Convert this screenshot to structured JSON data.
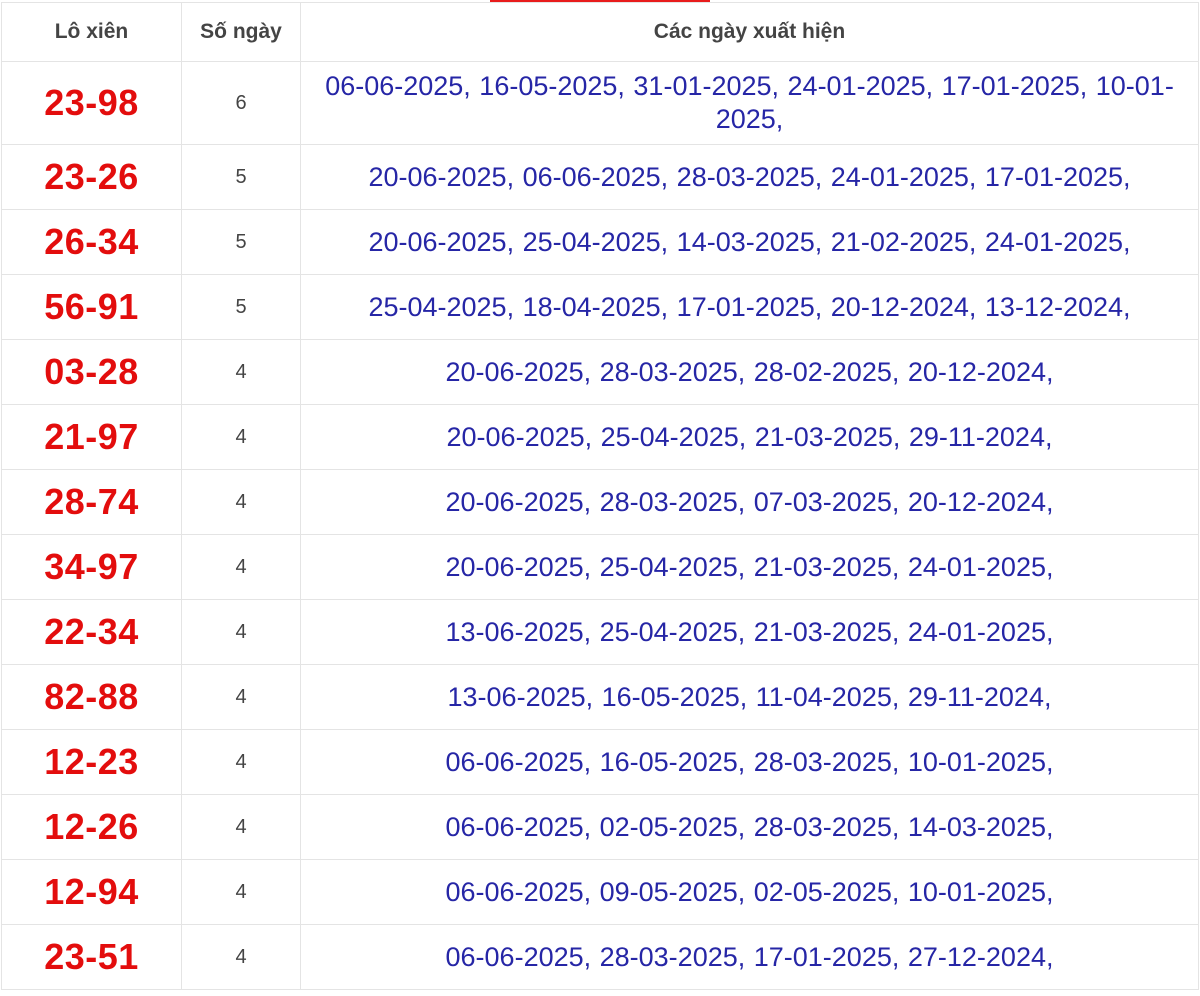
{
  "header": {
    "col_pair": "Lô xiên",
    "col_count": "Số ngày",
    "col_dates": "Các ngày xuất hiện"
  },
  "colors": {
    "accent": "#e81c1c",
    "pair_text": "#e30d0d",
    "dates_text": "#2626a6",
    "header_text": "#444444",
    "border": "#e4e4e4"
  },
  "rows": [
    {
      "pair": "23-98",
      "count": "6",
      "dates": "06-06-2025, 16-05-2025, 31-01-2025, 24-01-2025, 17-01-2025, 10-01-2025,"
    },
    {
      "pair": "23-26",
      "count": "5",
      "dates": "20-06-2025, 06-06-2025, 28-03-2025, 24-01-2025, 17-01-2025,"
    },
    {
      "pair": "26-34",
      "count": "5",
      "dates": "20-06-2025, 25-04-2025, 14-03-2025, 21-02-2025, 24-01-2025,"
    },
    {
      "pair": "56-91",
      "count": "5",
      "dates": "25-04-2025, 18-04-2025, 17-01-2025, 20-12-2024, 13-12-2024,"
    },
    {
      "pair": "03-28",
      "count": "4",
      "dates": "20-06-2025, 28-03-2025, 28-02-2025, 20-12-2024,"
    },
    {
      "pair": "21-97",
      "count": "4",
      "dates": "20-06-2025, 25-04-2025, 21-03-2025, 29-11-2024,"
    },
    {
      "pair": "28-74",
      "count": "4",
      "dates": "20-06-2025, 28-03-2025, 07-03-2025, 20-12-2024,"
    },
    {
      "pair": "34-97",
      "count": "4",
      "dates": "20-06-2025, 25-04-2025, 21-03-2025, 24-01-2025,"
    },
    {
      "pair": "22-34",
      "count": "4",
      "dates": "13-06-2025, 25-04-2025, 21-03-2025, 24-01-2025,"
    },
    {
      "pair": "82-88",
      "count": "4",
      "dates": "13-06-2025, 16-05-2025, 11-04-2025, 29-11-2024,"
    },
    {
      "pair": "12-23",
      "count": "4",
      "dates": "06-06-2025, 16-05-2025, 28-03-2025, 10-01-2025,"
    },
    {
      "pair": "12-26",
      "count": "4",
      "dates": "06-06-2025, 02-05-2025, 28-03-2025, 14-03-2025,"
    },
    {
      "pair": "12-94",
      "count": "4",
      "dates": "06-06-2025, 09-05-2025, 02-05-2025, 10-01-2025,"
    },
    {
      "pair": "23-51",
      "count": "4",
      "dates": "06-06-2025, 28-03-2025, 17-01-2025, 27-12-2024,"
    }
  ]
}
